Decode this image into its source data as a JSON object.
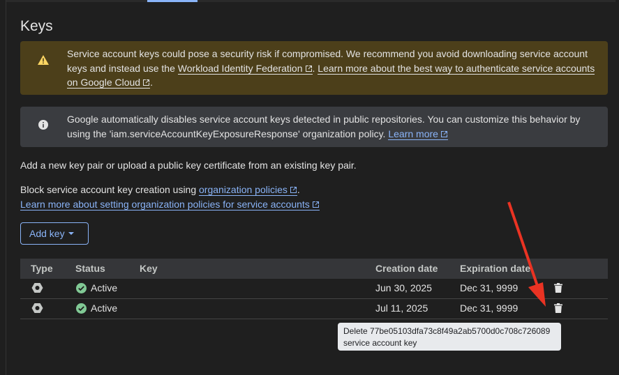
{
  "section_title": "Keys",
  "warning_banner": {
    "icon": "warning-icon",
    "text_1": "Service account keys could pose a security risk if compromised. We recommend you avoid downloading service account keys and instead use the ",
    "link_1": "Workload Identity Federation",
    "text_2": ". ",
    "link_2": "Learn more about the best way to authenticate service accounts on Google Cloud",
    "text_3": "."
  },
  "info_banner": {
    "icon": "info-icon",
    "text_1": "Google automatically disables service account keys detected in public repositories. You can customize this behavior by using the 'iam.serviceAccountKeyExposureResponse' organization policy. ",
    "link_1": "Learn more"
  },
  "intro_text": "Add a new key pair or upload a public key certificate from an existing key pair.",
  "block_text": "Block service account key creation using ",
  "org_policies_link": "organization policies",
  "block_text_end": ".",
  "learn_more_link": "Learn more about setting organization policies for service accounts",
  "add_key_button": "Add key",
  "table": {
    "headers": [
      "Type",
      "Status",
      "Key",
      "Creation date",
      "Expiration date"
    ],
    "rows": [
      {
        "type_icon": "key-type-icon",
        "status": "Active",
        "key": "",
        "creation_date": "Jun 30, 2025",
        "expiration_date": "Dec 31, 9999"
      },
      {
        "type_icon": "key-type-icon",
        "status": "Active",
        "key": "",
        "creation_date": "Jul 11, 2025",
        "expiration_date": "Dec 31, 9999"
      }
    ]
  },
  "tooltip": "Delete 77be05103dfa73c8f49a2ab5700d0c708c726089 service account key",
  "colors": {
    "background": "#1f1f1f",
    "accent": "#8ab4f8",
    "warning_bg": "#4c3f1a",
    "warning_icon": "#fdd663",
    "info_bg": "#3a3c40",
    "active_green": "#81c995",
    "annotation_arrow": "#ea3323"
  }
}
